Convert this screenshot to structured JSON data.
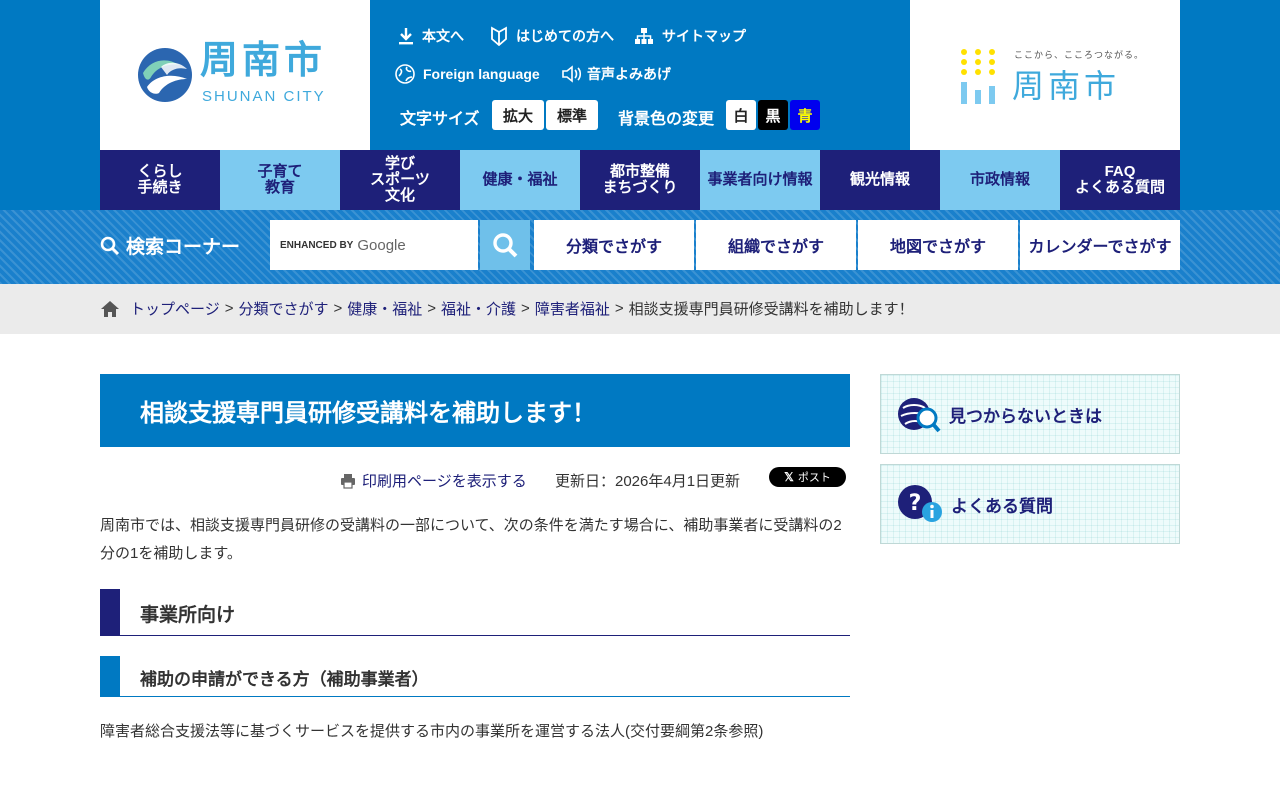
{
  "header": {
    "logo_name": "周南市",
    "logo_sub": "SHUNAN CITY",
    "util_links": {
      "skip": "本文へ",
      "first_time": "はじめての方へ",
      "sitemap": "サイトマップ",
      "foreign": "Foreign language",
      "voice": "音声よみあげ"
    },
    "font_size_label": "文字サイズ",
    "font_size_buttons": {
      "large": "拡大",
      "standard": "標準"
    },
    "bg_color_label": "背景色の変更",
    "bg_color_buttons": {
      "white": "白",
      "black": "黒",
      "blue": "青"
    },
    "brand_tagline": "ここから、こころつながる。",
    "brand_name": "周南市"
  },
  "global_nav": [
    {
      "label": "くらし\n手続き"
    },
    {
      "label": "子育て\n教育"
    },
    {
      "label": "学び\nスポーツ\n文化"
    },
    {
      "label": "健康・福祉"
    },
    {
      "label": "都市整備\nまちづくり"
    },
    {
      "label": "事業者向け情報"
    },
    {
      "label": "観光情報"
    },
    {
      "label": "市政情報"
    },
    {
      "label": "FAQ\nよくある質問"
    }
  ],
  "search": {
    "title": "検索コーナー",
    "enhanced_by": "ENHANCED BY",
    "google": "Google",
    "find_buttons": {
      "category": "分類でさがす",
      "organization": "組織でさがす",
      "map": "地図でさがす",
      "calendar": "カレンダーでさがす"
    }
  },
  "breadcrumb": {
    "items": [
      "トップページ",
      "分類でさがす",
      "健康・福祉",
      "福祉・介護",
      "障害者福祉"
    ],
    "current": "相談支援専門員研修受講料を補助します！",
    "separator": ">"
  },
  "main": {
    "title": "相談支援専門員研修受講料を補助します！",
    "print_link": "印刷用ページを表示する",
    "updated": "更新日：2026年4月1日更新",
    "x_post": "ポスト",
    "intro": "周南市では、相談支援専門員研修の受講料の一部について、次の条件を満たす場合に、補助事業者に受講料の2分の1を補助します。",
    "h2": "事業所向け",
    "h3": "補助の申請ができる方（補助事業者）",
    "body": "障害者総合支援法等に基づくサービスを提供する市内の事業所を運営する法人(交付要綱第2条参照)"
  },
  "sidebar": {
    "not_found": "見つからないときは",
    "faq": "よくある質問"
  },
  "colors": {
    "primary_blue": "#0079c2",
    "navy": "#1e2079",
    "light_blue": "#7dcaf0"
  }
}
